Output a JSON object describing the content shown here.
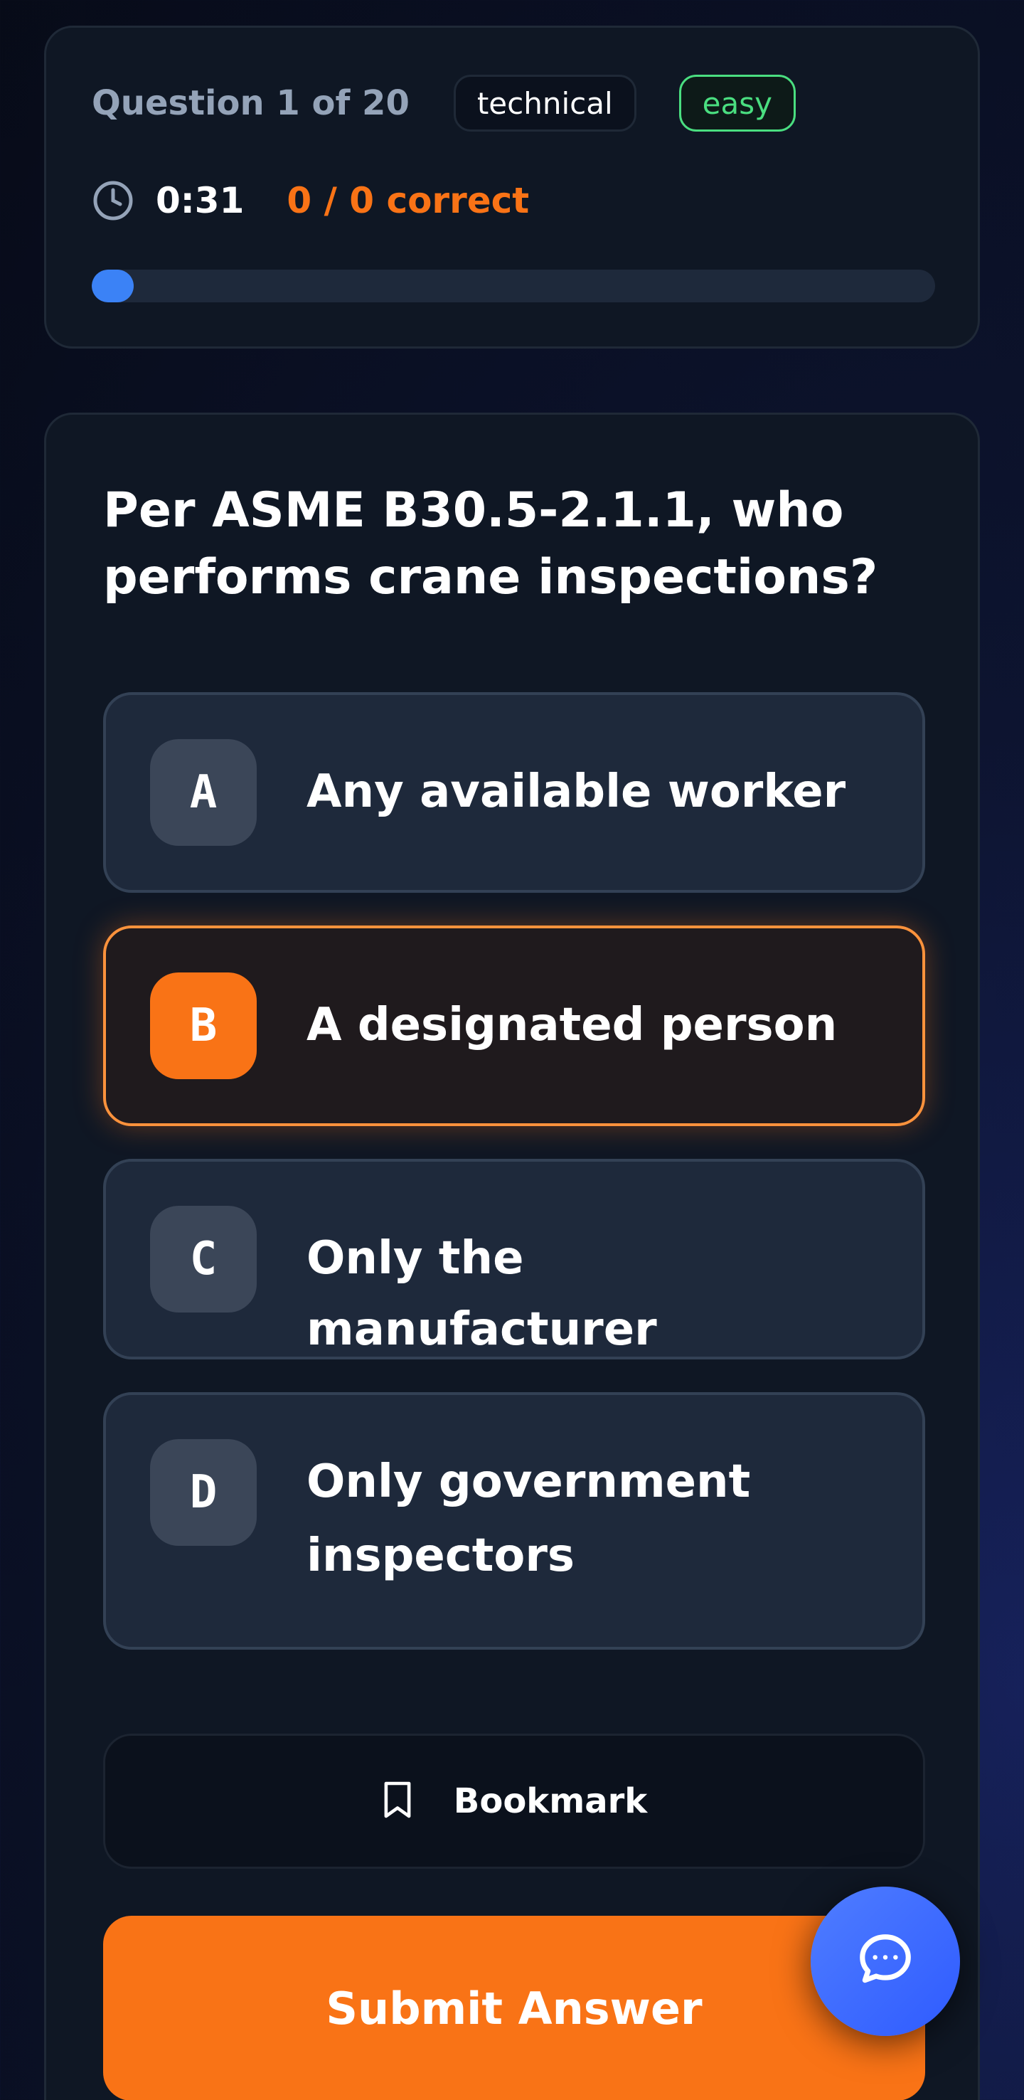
{
  "header": {
    "question_count": "Question 1 of 20",
    "category_tag": "technical",
    "difficulty_tag": "easy",
    "timer": "0:31",
    "score": "0 / 0 correct",
    "progress_fraction": 0.05
  },
  "question": {
    "text": "Per ASME B30.5-2.1.1, who performs crane inspections?",
    "options": [
      {
        "letter": "A",
        "text": "Any available worker",
        "selected": false
      },
      {
        "letter": "B",
        "text": "A designated person",
        "selected": true
      },
      {
        "letter": "C",
        "text": "Only the manufacturer",
        "selected": false
      },
      {
        "letter": "D",
        "text": "Only government inspectors",
        "selected": false
      }
    ]
  },
  "actions": {
    "bookmark_label": "Bookmark",
    "submit_label": "Submit Answer"
  },
  "colors": {
    "accent": "#f97316",
    "progress": "#3b82f6",
    "easy": "#4ade80",
    "fab": "#3b6bff"
  },
  "icons": {
    "timer": "clock-icon",
    "bookmark": "bookmark-icon",
    "chat": "chat-bubble-icon"
  }
}
